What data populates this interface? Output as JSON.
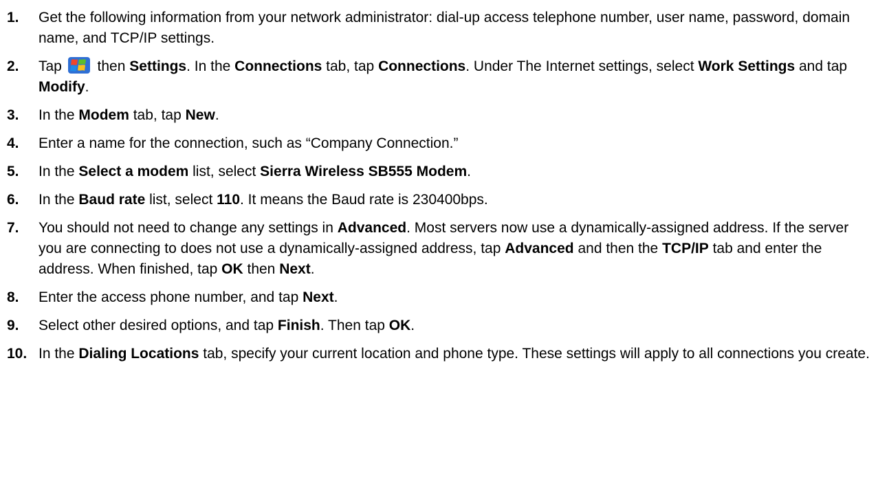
{
  "steps": [
    {
      "number": "1.",
      "segments": [
        {
          "text": "Get the following information from your network administrator: dial-up access telephone number, user name, password, domain name, and TCP/IP settings."
        }
      ]
    },
    {
      "number": "2.",
      "segments": [
        {
          "text": "Tap "
        },
        {
          "icon": "windows-start-icon"
        },
        {
          "text": " then "
        },
        {
          "text": "Settings",
          "bold": true
        },
        {
          "text": ". In the "
        },
        {
          "text": "Connections",
          "bold": true
        },
        {
          "text": " tab, tap "
        },
        {
          "text": "Connections",
          "bold": true
        },
        {
          "text": ". Under The Internet settings, select "
        },
        {
          "text": "Work Settings",
          "bold": true
        },
        {
          "text": " and tap "
        },
        {
          "text": "Modify",
          "bold": true
        },
        {
          "text": "."
        }
      ]
    },
    {
      "number": "3.",
      "segments": [
        {
          "text": "In the "
        },
        {
          "text": "Modem",
          "bold": true
        },
        {
          "text": " tab, tap "
        },
        {
          "text": "New",
          "bold": true
        },
        {
          "text": "."
        }
      ]
    },
    {
      "number": "4.",
      "segments": [
        {
          "text": "Enter a name for the connection, such as “Company Connection.”"
        }
      ]
    },
    {
      "number": "5.",
      "segments": [
        {
          "text": "In the "
        },
        {
          "text": "Select a modem",
          "bold": true
        },
        {
          "text": " list, select "
        },
        {
          "text": "Sierra Wireless SB555 Modem",
          "bold": true
        },
        {
          "text": "."
        }
      ]
    },
    {
      "number": "6.",
      "segments": [
        {
          "text": "In the "
        },
        {
          "text": "Baud rate",
          "bold": true
        },
        {
          "text": " list, select "
        },
        {
          "text": "110",
          "bold": true
        },
        {
          "text": ". It means the Baud rate is 230400bps."
        }
      ]
    },
    {
      "number": "7.",
      "segments": [
        {
          "text": "You should not need to change any settings in "
        },
        {
          "text": "Advanced",
          "bold": true
        },
        {
          "text": ". Most servers now use a dynamically-assigned address. If the server you are connecting to does not use a dynamically-assigned address, tap "
        },
        {
          "text": "Advanced",
          "bold": true
        },
        {
          "text": " and then the "
        },
        {
          "text": "TCP/IP",
          "bold": true
        },
        {
          "text": " tab and enter the address. When finished, tap "
        },
        {
          "text": "OK",
          "bold": true
        },
        {
          "text": " then "
        },
        {
          "text": "Next",
          "bold": true
        },
        {
          "text": "."
        }
      ]
    },
    {
      "number": "8.",
      "segments": [
        {
          "text": "Enter the access phone number, and tap "
        },
        {
          "text": "Next",
          "bold": true
        },
        {
          "text": "."
        }
      ]
    },
    {
      "number": "9.",
      "segments": [
        {
          "text": "Select other desired options, and tap "
        },
        {
          "text": "Finish",
          "bold": true
        },
        {
          "text": ". Then tap "
        },
        {
          "text": "OK",
          "bold": true
        },
        {
          "text": "."
        }
      ]
    },
    {
      "number": "10.",
      "segments": [
        {
          "text": "In the "
        },
        {
          "text": "Dialing Locations",
          "bold": true
        },
        {
          "text": " tab, specify your current location and phone type. These settings will apply to all connections you create."
        }
      ]
    }
  ],
  "colors": {
    "text": "#000000",
    "background": "#ffffff",
    "icon_backdrop": "#2f6fd4",
    "flag_red": "#f0462a",
    "flag_green": "#5cbf2a",
    "flag_blue": "#1e8ae8",
    "flag_yellow": "#fbc21b"
  }
}
